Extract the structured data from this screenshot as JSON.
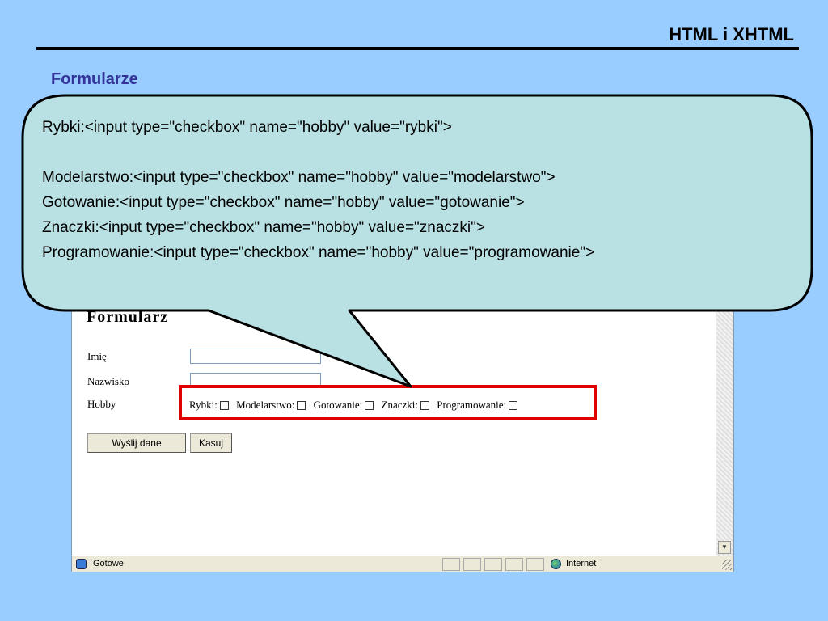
{
  "slide": {
    "title": "HTML i XHTML",
    "subtitle": "Formularze"
  },
  "form": {
    "heading": "Formularz",
    "first_name_label": "Imię",
    "last_name_label": "Nazwisko",
    "hobby_label": "Hobby",
    "first_name_value": "",
    "last_name_value": "",
    "hobbies": [
      "Rybki:",
      "Modelarstwo:",
      "Gotowanie:",
      "Znaczki:",
      "Programowanie:"
    ],
    "submit_label": "Wyślij dane",
    "reset_label": "Kasuj"
  },
  "statusbar": {
    "status": "Gotowe",
    "zone": "Internet"
  },
  "callout": {
    "lines": [
      "Rybki:<input type=\"checkbox\" name=\"hobby\" value=\"rybki\">",
      "",
      "Modelarstwo:<input type=\"checkbox\" name=\"hobby\" value=\"modelarstwo\">",
      "Gotowanie:<input type=\"checkbox\" name=\"hobby\" value=\"gotowanie\">",
      "Znaczki:<input type=\"checkbox\" name=\"hobby\" value=\"znaczki\">",
      "Programowanie:<input type=\"checkbox\" name=\"hobby\" value=\"programowanie\">"
    ]
  },
  "colors": {
    "background": "#99ccff",
    "subtitle": "#333399",
    "callout_fill": "#b9e0e3",
    "highlight": "#e00000"
  }
}
